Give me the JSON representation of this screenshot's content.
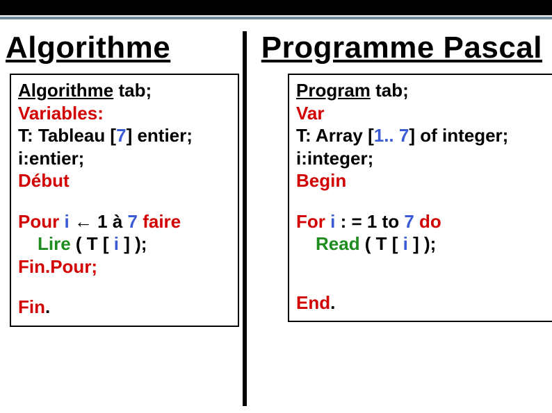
{
  "headings": {
    "left": "Algorithme",
    "right": "Programme Pascal"
  },
  "left": {
    "l1a": "Algorithme",
    "l1b": " tab;",
    "l2": "Variables:",
    "l3a": "T: Tableau [",
    "l3b": "7",
    "l3c": "] entier;",
    "l4": "i:entier;",
    "l5": "Début",
    "l6a": "Pour ",
    "l6b": "i",
    "l6c": " ← 1 à ",
    "l6d": "7",
    "l6e": " faire",
    "l7a": "Lire",
    "l7b": " ( T [",
    "l7c": " i ",
    "l7d": "] );",
    "l8": "Fin.Pour;",
    "l9a": "Fin",
    "l9b": "."
  },
  "right": {
    "l1a": "Program",
    "l1b": " tab;",
    "l2": "Var",
    "l3a": "T: Array [",
    "l3b": "1.. 7",
    "l3c": "] of integer;",
    "l4": "i:integer;",
    "l5": "Begin",
    "l6a": "For ",
    "l6b": "i",
    "l6c": " : = 1 to ",
    "l6d": "7",
    "l6e": " do",
    "l7a": "Read",
    "l7b": " ( T [",
    "l7c": " i ",
    "l7d": "] );",
    "l8a": "End",
    "l8b": "."
  }
}
